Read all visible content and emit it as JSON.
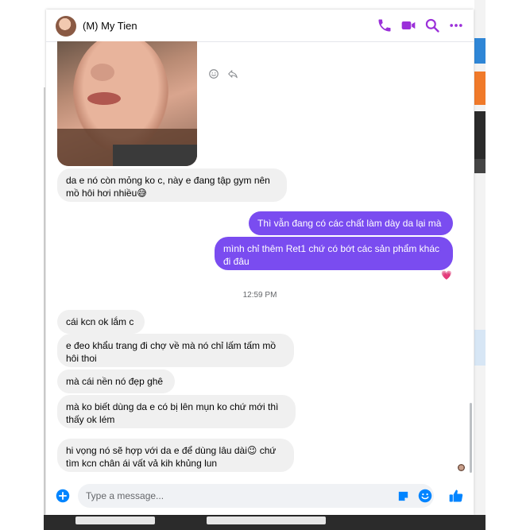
{
  "header": {
    "contact_name": "(M) My Tien",
    "icons": [
      "phone-icon",
      "video-call-icon",
      "search-icon",
      "more-options-icon"
    ]
  },
  "messages": [
    {
      "side": "in",
      "text": "da e nó còn mỏng ko c, này e đang tập gym nên\nmồ hôi hơi nhiều",
      "emoji": "😅"
    },
    {
      "side": "out",
      "text": "Thì vẫn đang có các chất làm dày da lại mà"
    },
    {
      "side": "out",
      "text": "mình chỉ thêm Ret1 chứ có bớt các sản phẩm khác\nđi đâu"
    },
    {
      "side": "in",
      "text": "cái kcn ok lắm c"
    },
    {
      "side": "in",
      "text": "e đeo khẩu trang đi chợ về mà nó chỉ lấm tấm mồ\nhôi thoi"
    },
    {
      "side": "in",
      "text": "mà cái nền nó đẹp ghê"
    },
    {
      "side": "in",
      "text": "mà ko biết dùng da e có bị lên mụn ko chứ mới thì\nthấy ok lém"
    },
    {
      "side": "in",
      "text": "hi vọng nó sẽ hợp với da e để dùng lâu dài",
      "emoji": "😉",
      "text_after": " chứ\ntìm kcn chân ái vất vả kih khủng lun"
    }
  ],
  "reaction": "💗",
  "timestamp": "12:59 PM",
  "composer": {
    "placeholder": "Type a message..."
  },
  "colors": {
    "accent": "#7a4cf0",
    "icon": "#9b30d9",
    "incoming_bubble": "#f0f0f0",
    "composer_icon": "#0084ff"
  }
}
